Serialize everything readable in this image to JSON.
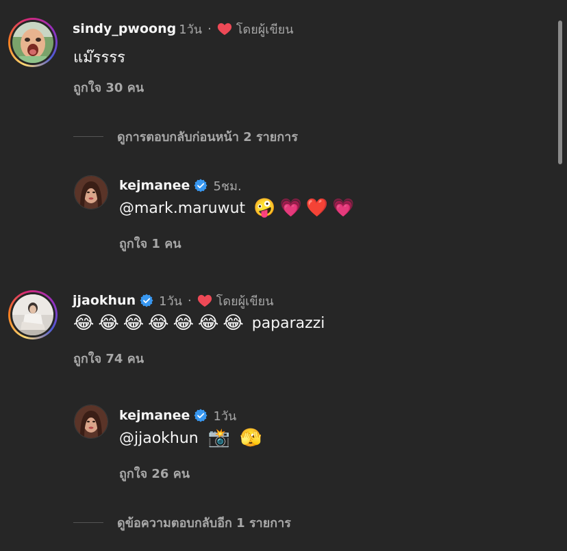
{
  "comments": [
    {
      "username": "sindy_pwoong",
      "time": "1วัน",
      "separator": "·",
      "author_liked_label": "โดยผู้เขียน",
      "text": "แม๊รรรร",
      "likes": "ถูกใจ 30 คน"
    },
    {
      "username": "jjaokhun",
      "time": "1วัน",
      "separator": "·",
      "author_liked_label": "โดยผู้เขียน",
      "text_suffix": "paparazzi",
      "emojis": [
        "😂",
        "😂",
        "😂",
        "😂",
        "😂",
        "😂",
        "😂"
      ],
      "likes": "ถูกใจ 74 คน"
    }
  ],
  "replies": [
    {
      "username": "kejmanee",
      "time": "5ชม.",
      "mention": "@mark.maruwut",
      "emojis": [
        "🤪",
        "💗",
        "❤️",
        "💗"
      ],
      "likes": "ถูกใจ 1 คน"
    },
    {
      "username": "kejmanee",
      "time": "1วัน",
      "mention": "@jjaokhun",
      "emojis": [
        "📸",
        "🫣"
      ],
      "likes": "ถูกใจ 26 คน"
    }
  ],
  "thread_toggles": {
    "previous": "ดูการตอบกลับก่อนหน้า 2 รายการ",
    "more": "ดูข้อความตอบกลับอีก 1 รายการ"
  },
  "colors": {
    "background": "#262626",
    "text": "#f5f5f5",
    "secondary": "#a8a8a8",
    "verified": "#3897f0",
    "heart": "#ed4956"
  }
}
